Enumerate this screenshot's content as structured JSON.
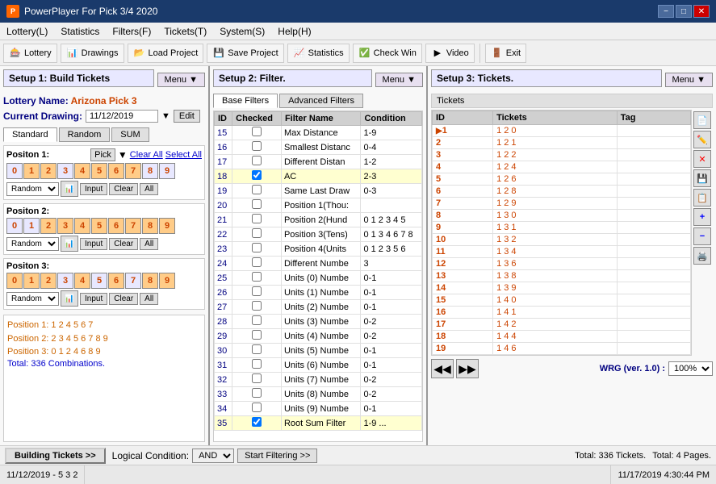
{
  "window": {
    "title": "PowerPlayer For Pick 3/4 2020",
    "min_label": "−",
    "max_label": "□",
    "close_label": "✕"
  },
  "menubar": {
    "items": [
      {
        "id": "lottery",
        "label": "Lottery(L)"
      },
      {
        "id": "statistics",
        "label": "Statistics"
      },
      {
        "id": "filters",
        "label": "Filters(F)"
      },
      {
        "id": "tickets",
        "label": "Tickets(T)"
      },
      {
        "id": "system",
        "label": "System(S)"
      },
      {
        "id": "help",
        "label": "Help(H)"
      }
    ]
  },
  "toolbar": {
    "lottery_label": "Lottery",
    "drawings_label": "Drawings",
    "load_project_label": "Load Project",
    "save_project_label": "Save Project",
    "statistics_label": "Statistics",
    "check_win_label": "Check Win",
    "video_label": "Video",
    "exit_label": "Exit"
  },
  "left_panel": {
    "header": "Setup 1: Build  Tickets",
    "menu_label": "Menu ▼",
    "lottery_name_label": "Lottery  Name:",
    "lottery_name_value": "Arizona Pick 3",
    "current_drawing_label": "Current Drawing:",
    "current_drawing_value": "11/12/2019",
    "edit_label": "Edit",
    "tabs": [
      "Standard",
      "Random",
      "SUM"
    ],
    "active_tab": "Standard",
    "positions": [
      {
        "label": "Positon 1:",
        "pick_label": "Pick",
        "clear_all_label": "Clear All",
        "select_all_label": "Select All",
        "digits": [
          "0",
          "1",
          "2",
          "3",
          "4",
          "5",
          "6",
          "7",
          "8",
          "9"
        ],
        "random_label": "Random",
        "clear_label": "Clear",
        "all_label": "All"
      },
      {
        "label": "Positon 2:",
        "pick_label": "Pick",
        "clear_all_label": "",
        "select_all_label": "",
        "digits": [
          "0",
          "1",
          "2",
          "3",
          "4",
          "5",
          "6",
          "7",
          "8",
          "9"
        ],
        "random_label": "Random",
        "clear_label": "Clear",
        "all_label": "All"
      },
      {
        "label": "Positon 3:",
        "pick_label": "Pick",
        "clear_all_label": "",
        "select_all_label": "",
        "digits": [
          "0",
          "1",
          "2",
          "3",
          "4",
          "5",
          "6",
          "7",
          "8",
          "9"
        ],
        "random_label": "Random",
        "clear_label": "Clear",
        "all_label": "All"
      }
    ],
    "combos": [
      "Position 1: 1 2 4 5 6 7",
      "Position 2: 2 3 4 5 6 7 8 9",
      "Position 3: 0 1 2 4 6 8 9"
    ],
    "total": "Total: 336 Combinations."
  },
  "mid_panel": {
    "header": "Setup 2: Filter.",
    "menu_label": "Menu ▼",
    "base_filters_label": "Base Filters",
    "advanced_filters_label": "Advanced Filters",
    "columns": [
      "ID",
      "Checked",
      "Filter Name",
      "Condition"
    ],
    "filters": [
      {
        "id": 15,
        "checked": false,
        "name": "Max Distance",
        "condition": "1-9"
      },
      {
        "id": 16,
        "checked": false,
        "name": "Smallest Distanc",
        "condition": "0-4"
      },
      {
        "id": 17,
        "checked": false,
        "name": "Different Distan",
        "condition": "1-2"
      },
      {
        "id": 18,
        "checked": true,
        "name": "AC",
        "condition": "2-3"
      },
      {
        "id": 19,
        "checked": false,
        "name": "Same Last Draw",
        "condition": "0-3"
      },
      {
        "id": 20,
        "checked": false,
        "name": "Position 1(Thou:",
        "condition": ""
      },
      {
        "id": 21,
        "checked": false,
        "name": "Position 2(Hund",
        "condition": "0 1 2 3 4 5"
      },
      {
        "id": 22,
        "checked": false,
        "name": "Position 3(Tens)",
        "condition": "0 1 3 4 6 7 8"
      },
      {
        "id": 23,
        "checked": false,
        "name": "Position 4(Units",
        "condition": "0 1 2 3 5 6"
      },
      {
        "id": 24,
        "checked": false,
        "name": "Different Numbe",
        "condition": "3"
      },
      {
        "id": 25,
        "checked": false,
        "name": "Units (0) Numbe",
        "condition": "0-1"
      },
      {
        "id": 26,
        "checked": false,
        "name": "Units (1) Numbe",
        "condition": "0-1"
      },
      {
        "id": 27,
        "checked": false,
        "name": "Units (2) Numbe",
        "condition": "0-1"
      },
      {
        "id": 28,
        "checked": false,
        "name": "Units (3) Numbe",
        "condition": "0-2"
      },
      {
        "id": 29,
        "checked": false,
        "name": "Units (4) Numbe",
        "condition": "0-2"
      },
      {
        "id": 30,
        "checked": false,
        "name": "Units (5) Numbe",
        "condition": "0-1"
      },
      {
        "id": 31,
        "checked": false,
        "name": "Units (6) Numbe",
        "condition": "0-1"
      },
      {
        "id": 32,
        "checked": false,
        "name": "Units (7) Numbe",
        "condition": "0-2"
      },
      {
        "id": 33,
        "checked": false,
        "name": "Units (8) Numbe",
        "condition": "0-2"
      },
      {
        "id": 34,
        "checked": false,
        "name": "Units (9) Numbe",
        "condition": "0-1"
      },
      {
        "id": 35,
        "checked": true,
        "name": "Root Sum Filter",
        "condition": "1-9"
      }
    ],
    "logical_condition_label": "Logical Condition:",
    "logical_condition_value": "AND",
    "start_filtering_label": "Start Filtering >>"
  },
  "right_panel": {
    "header": "Setup 3: Tickets.",
    "menu_label": "Menu ▼",
    "tickets_tab": "Tickets",
    "columns": [
      "ID",
      "Tickets",
      "Tag"
    ],
    "tickets": [
      {
        "id": 1,
        "number": "1 2 0",
        "tag": "",
        "arrow": true
      },
      {
        "id": 2,
        "number": "1 2 1",
        "tag": ""
      },
      {
        "id": 3,
        "number": "1 2 2",
        "tag": ""
      },
      {
        "id": 4,
        "number": "1 2 4",
        "tag": ""
      },
      {
        "id": 5,
        "number": "1 2 6",
        "tag": ""
      },
      {
        "id": 6,
        "number": "1 2 8",
        "tag": ""
      },
      {
        "id": 7,
        "number": "1 2 9",
        "tag": ""
      },
      {
        "id": 8,
        "number": "1 3 0",
        "tag": ""
      },
      {
        "id": 9,
        "number": "1 3 1",
        "tag": ""
      },
      {
        "id": 10,
        "number": "1 3 2",
        "tag": ""
      },
      {
        "id": 11,
        "number": "1 3 4",
        "tag": ""
      },
      {
        "id": 12,
        "number": "1 3 6",
        "tag": ""
      },
      {
        "id": 13,
        "number": "1 3 8",
        "tag": ""
      },
      {
        "id": 14,
        "number": "1 3 9",
        "tag": ""
      },
      {
        "id": 15,
        "number": "1 4 0",
        "tag": ""
      },
      {
        "id": 16,
        "number": "1 4 1",
        "tag": ""
      },
      {
        "id": 17,
        "number": "1 4 2",
        "tag": ""
      },
      {
        "id": 18,
        "number": "1 4 4",
        "tag": ""
      },
      {
        "id": 19,
        "number": "1 4 6",
        "tag": ""
      }
    ],
    "nav_first_label": "◀◀",
    "nav_next_label": "▶▶",
    "wrg_label": "WRG (ver. 1.0) :",
    "zoom_value": "100%",
    "right_buttons": [
      "📄",
      "✏️",
      "✕",
      "💾",
      "📋",
      "➕",
      "➖",
      "🖨️"
    ]
  },
  "bottom_bar": {
    "build_tickets_label": "Building  Tickets >>",
    "logical_label": "Logical Condition:",
    "logical_value": "AND",
    "start_filter_label": "Start Filtering >>"
  },
  "status_bar": {
    "date_value": "11/12/2019 - 5 3 2",
    "total_tickets": "Total: 336 Tickets.",
    "total_pages": "Total: 4 Pages.",
    "datetime": "11/17/2019 4:30:44 PM"
  }
}
